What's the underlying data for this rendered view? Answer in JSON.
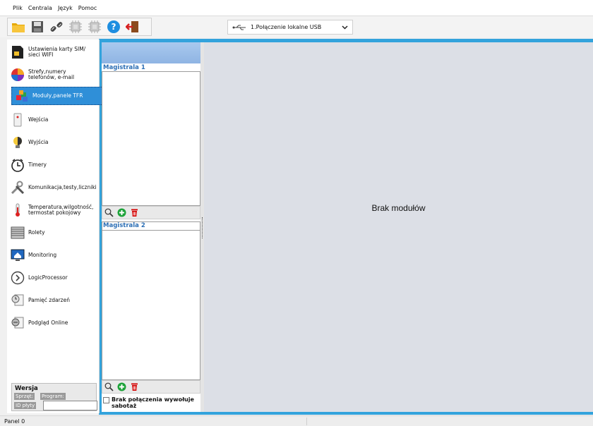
{
  "menu": [
    "Plik",
    "Centrala",
    "Język",
    "Pomoc"
  ],
  "toolbar": {
    "connection": "1.Połączenie lokalne USB"
  },
  "sidebar": {
    "items": [
      {
        "label": "Ustawienia karty SIM/ sieci WIFI",
        "icon": "sim-card-icon"
      },
      {
        "label": "Strefy,numery telefonów, e-mail",
        "icon": "zones-pie-icon"
      },
      {
        "label": "Moduły,panele TFR",
        "icon": "modules-icon",
        "active": true
      },
      {
        "label": "Wejścia",
        "icon": "motion-sensor-icon"
      },
      {
        "label": "Wyjścia",
        "icon": "bulb-icon"
      },
      {
        "label": "Timery",
        "icon": "clock-icon"
      },
      {
        "label": "Komunikacja,testy,liczniki",
        "icon": "tools-icon"
      },
      {
        "label": "Temperatura,wilgotność, termostat pokojowy",
        "icon": "thermometer-icon"
      },
      {
        "label": "Rolety",
        "icon": "shutter-icon"
      },
      {
        "label": "Monitoring",
        "icon": "monitor-home-icon"
      },
      {
        "label": "LogicProcessor",
        "icon": "logic-head-icon"
      },
      {
        "label": "Pamięć zdarzeń",
        "icon": "event-memory-icon"
      },
      {
        "label": "Podgląd Online",
        "icon": "online-preview-icon"
      }
    ]
  },
  "version": {
    "title": "Wersja",
    "hardware": "Sprzęt:",
    "program": "Program:",
    "board_id": "ID płyty"
  },
  "buses": {
    "bus1": "Magistrala 1",
    "bus2": "Magistrala 2",
    "sabotage": "Brak połączenia wywołuje sabotaż"
  },
  "main": {
    "empty": "Brak modułów"
  },
  "status": {
    "panel": "Panel 0"
  },
  "colors": {
    "accent": "#33a3dc",
    "active": "#2f8fd8",
    "bus_label": "#2d6fb5"
  }
}
